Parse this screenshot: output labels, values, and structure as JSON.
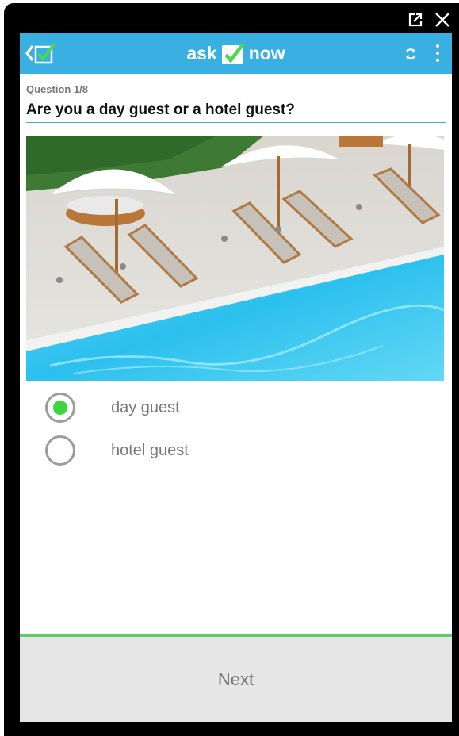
{
  "appbar": {
    "brand_left": "ask",
    "brand_right": "now"
  },
  "question": {
    "counter": "Question 1/8",
    "title": "Are you a day guest or a hotel guest?"
  },
  "options": [
    {
      "label": "day guest",
      "selected": true
    },
    {
      "label": "hotel guest",
      "selected": false
    }
  ],
  "footer": {
    "next_label": "Next"
  },
  "colors": {
    "accent": "#3ab0e2",
    "selected": "#3ed63e",
    "footer_line": "#65c96a"
  },
  "icons": {
    "back": "chevron-left-icon",
    "logo": "checkbox-check-icon",
    "refresh": "refresh-icon",
    "menu": "more-vertical-icon",
    "external": "external-link-icon",
    "close": "close-icon"
  }
}
